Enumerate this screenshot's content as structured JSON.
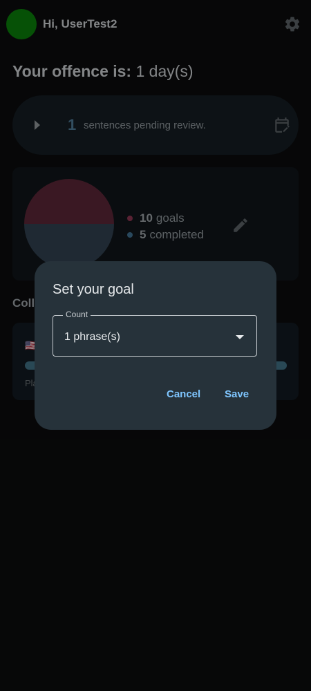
{
  "header": {
    "greeting": "Hi, UserTest2",
    "avatar_color": "#0a7d0a",
    "settings_icon": "gear-icon"
  },
  "offence": {
    "label": "Your offence is:",
    "value": "1 day(s)"
  },
  "pending": {
    "count": "1",
    "text": "sentences pending review.",
    "icon": "calendar-edit-icon"
  },
  "goals": {
    "chart_colors": {
      "goals": "#5a2636",
      "completed": "#30404f"
    },
    "goals_count": "10",
    "goals_label": "goals",
    "completed_count": "5",
    "completed_label": "completed",
    "edit_icon": "pencil-icon"
  },
  "collections": {
    "title": "Coll",
    "card_sub": "Pla",
    "flag": "🇺🇸"
  },
  "dialog": {
    "title": "Set your goal",
    "field_label": "Count",
    "field_value": "1 phrase(s)",
    "cancel": "Cancel",
    "save": "Save"
  }
}
